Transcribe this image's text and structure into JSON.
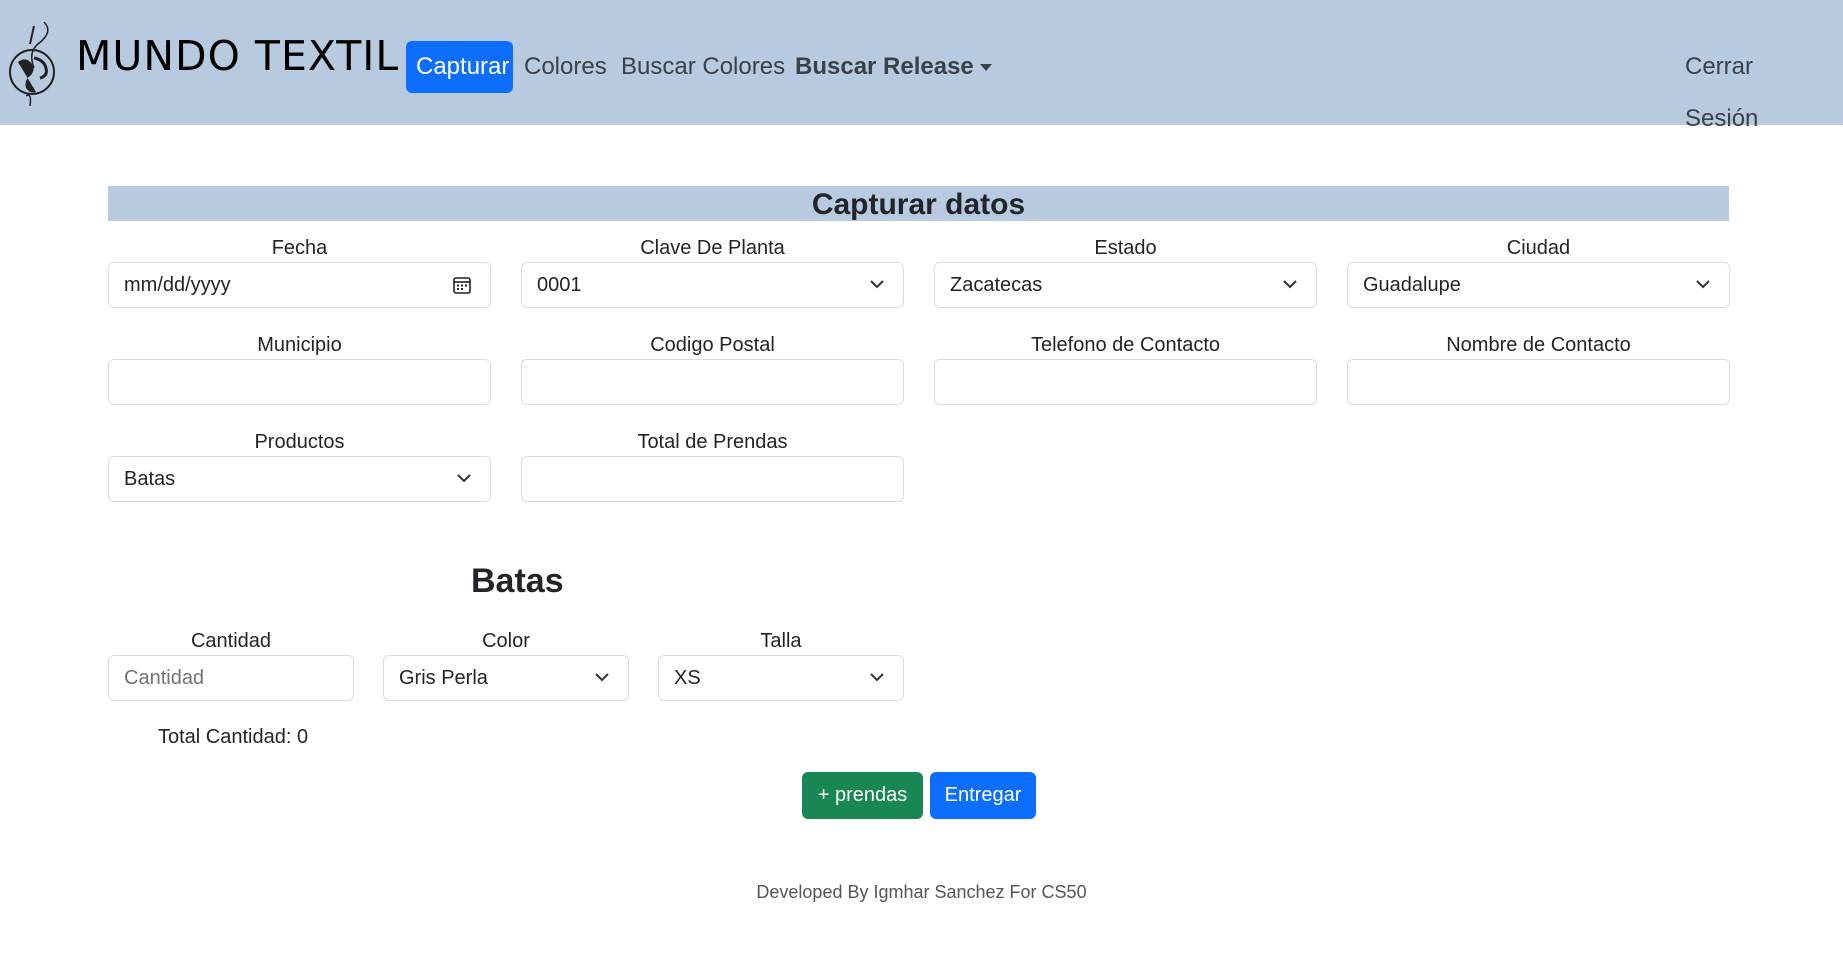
{
  "navbar": {
    "brand": "MUNDO TEXTIL",
    "links": [
      {
        "label": "Capturar"
      },
      {
        "label": "Colores"
      },
      {
        "label": "Buscar Colores"
      },
      {
        "label": "Buscar Release"
      }
    ],
    "logout": "Cerrar Sesión"
  },
  "form": {
    "title": "Capturar datos",
    "fecha": {
      "label": "Fecha",
      "value": "mm/dd/yyyy"
    },
    "clave_planta": {
      "label": "Clave De Planta",
      "value": "0001"
    },
    "estado": {
      "label": "Estado",
      "value": "Zacatecas"
    },
    "ciudad": {
      "label": "Ciudad",
      "value": "Guadalupe"
    },
    "municipio": {
      "label": "Municipio",
      "value": ""
    },
    "codigo_postal": {
      "label": "Codigo Postal",
      "value": ""
    },
    "telefono": {
      "label": "Telefono de Contacto",
      "value": ""
    },
    "nombre_contacto": {
      "label": "Nombre de Contacto",
      "value": ""
    },
    "productos": {
      "label": "Productos",
      "value": "Batas"
    },
    "total_prendas": {
      "label": "Total de Prendas",
      "value": ""
    }
  },
  "product_section": {
    "title": "Batas",
    "cantidad": {
      "label": "Cantidad",
      "placeholder": "Cantidad"
    },
    "color": {
      "label": "Color",
      "value": "Gris Perla"
    },
    "talla": {
      "label": "Talla",
      "value": "XS"
    },
    "total": "Total Cantidad: 0"
  },
  "buttons": {
    "add": "+ prendas",
    "submit": "Entregar"
  },
  "footer": "Developed By Igmhar Sanchez For CS50"
}
